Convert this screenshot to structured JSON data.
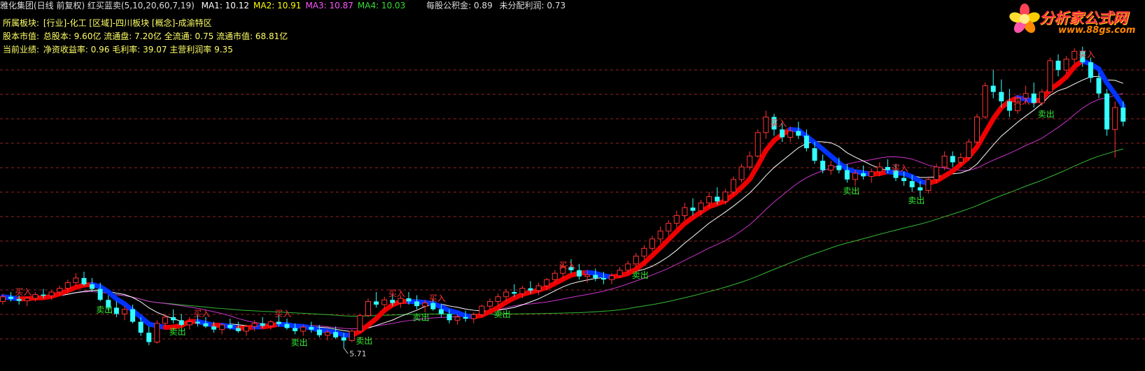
{
  "header": {
    "title": "雅化集团(日线 前复权) 红买蓝卖(5,10,20,60,7,19)",
    "ma": [
      {
        "label": "MA1",
        "value": "10.12",
        "color": "#ffffff"
      },
      {
        "label": "MA2",
        "value": "10.91",
        "color": "#ffff00"
      },
      {
        "label": "MA3",
        "value": "10.87",
        "color": "#ff55ff"
      },
      {
        "label": "MA4",
        "value": "10.03",
        "color": "#33dd33"
      }
    ],
    "per_share_reserve": "每股公积金: 0.89",
    "undistributed_profit": "未分配利润: 0.73"
  },
  "info": {
    "sector_label": "所属板块:",
    "sector_value": "[行业]-化工 [区域]-四川板块 [概念]-成渝特区",
    "capital_label": "股本市值:",
    "capital_value": "总股本: 9.60亿 流通盘: 7.20亿 全流通: 0.75 流通市值: 68.81亿",
    "perf_label": "当前业绩:",
    "perf_value": "净资收益率: 0.96 毛利率: 39.07 主营利润率 9.35"
  },
  "logo": {
    "name": "分析家公式网",
    "url": "www.88gs.com"
  },
  "colors": {
    "up": "#ff3333",
    "down": "#33ffff",
    "buy_band": "#ee0000",
    "sell_band": "#0033ff",
    "ma1": "#ffffff",
    "ma3": "#cc33cc",
    "ma4": "#33bb33",
    "grid": "#992222",
    "buy_text": "#ff3333",
    "sell_text": "#33ee33"
  },
  "chart_data": {
    "type": "candlestick",
    "title": "雅化集团(日线 前复权)",
    "low_marker": "5.71",
    "ohlc": [
      [
        7.2,
        7.45,
        7.1,
        7.35
      ],
      [
        7.35,
        7.5,
        7.2,
        7.28
      ],
      [
        7.28,
        7.4,
        7.1,
        7.22
      ],
      [
        7.22,
        7.35,
        7.05,
        7.3
      ],
      [
        7.3,
        7.5,
        7.2,
        7.42
      ],
      [
        7.42,
        7.6,
        7.3,
        7.38
      ],
      [
        7.38,
        7.55,
        7.25,
        7.5
      ],
      [
        7.5,
        7.7,
        7.4,
        7.62
      ],
      [
        7.62,
        7.9,
        7.5,
        7.8
      ],
      [
        7.8,
        8.1,
        7.7,
        7.95
      ],
      [
        7.95,
        8.15,
        7.7,
        7.75
      ],
      [
        7.75,
        7.95,
        7.5,
        7.6
      ],
      [
        7.6,
        7.8,
        7.2,
        7.25
      ],
      [
        7.25,
        7.4,
        6.9,
        7.0
      ],
      [
        7.0,
        7.2,
        6.7,
        6.8
      ],
      [
        6.8,
        7.05,
        6.6,
        6.95
      ],
      [
        6.95,
        7.1,
        6.5,
        6.55
      ],
      [
        6.55,
        6.7,
        6.1,
        6.2
      ],
      [
        6.2,
        6.4,
        5.8,
        5.9
      ],
      [
        5.9,
        6.6,
        5.85,
        6.5
      ],
      [
        6.5,
        6.8,
        6.4,
        6.7
      ],
      [
        6.7,
        6.95,
        6.5,
        6.6
      ],
      [
        6.6,
        6.8,
        6.4,
        6.45
      ],
      [
        6.45,
        6.7,
        6.3,
        6.55
      ],
      [
        6.55,
        6.75,
        6.4,
        6.5
      ],
      [
        6.5,
        6.7,
        6.35,
        6.4
      ],
      [
        6.4,
        6.55,
        6.2,
        6.3
      ],
      [
        6.3,
        6.5,
        6.15,
        6.45
      ],
      [
        6.45,
        6.65,
        6.3,
        6.35
      ],
      [
        6.35,
        6.55,
        6.2,
        6.25
      ],
      [
        6.25,
        6.45,
        6.1,
        6.4
      ],
      [
        6.4,
        6.6,
        6.25,
        6.5
      ],
      [
        6.5,
        6.7,
        6.35,
        6.42
      ],
      [
        6.42,
        6.6,
        6.3,
        6.55
      ],
      [
        6.55,
        6.75,
        6.4,
        6.48
      ],
      [
        6.48,
        6.65,
        6.3,
        6.35
      ],
      [
        6.35,
        6.5,
        6.15,
        6.25
      ],
      [
        6.25,
        6.45,
        6.1,
        6.38
      ],
      [
        6.38,
        6.55,
        6.2,
        6.3
      ],
      [
        6.3,
        6.45,
        6.05,
        6.12
      ],
      [
        6.12,
        6.3,
        5.95,
        6.22
      ],
      [
        6.22,
        6.4,
        6.0,
        6.05
      ],
      [
        6.05,
        6.2,
        5.71,
        5.95
      ],
      [
        5.95,
        6.3,
        5.9,
        6.25
      ],
      [
        6.25,
        6.8,
        6.2,
        6.75
      ],
      [
        6.75,
        7.3,
        6.7,
        7.2
      ],
      [
        7.2,
        7.5,
        7.0,
        7.1
      ],
      [
        7.1,
        7.35,
        6.95,
        7.25
      ],
      [
        7.25,
        7.45,
        7.05,
        7.15
      ],
      [
        7.15,
        7.4,
        7.0,
        7.3
      ],
      [
        7.3,
        7.5,
        7.1,
        7.2
      ],
      [
        7.2,
        7.4,
        6.95,
        7.05
      ],
      [
        7.05,
        7.25,
        6.85,
        7.15
      ],
      [
        7.15,
        7.3,
        6.9,
        6.95
      ],
      [
        6.95,
        7.1,
        6.7,
        6.8
      ],
      [
        6.8,
        6.95,
        6.5,
        6.6
      ],
      [
        6.6,
        6.8,
        6.45,
        6.7
      ],
      [
        6.7,
        6.9,
        6.55,
        6.65
      ],
      [
        6.65,
        6.85,
        6.5,
        6.78
      ],
      [
        6.78,
        7.1,
        6.7,
        7.05
      ],
      [
        7.05,
        7.3,
        6.95,
        7.2
      ],
      [
        7.2,
        7.45,
        7.05,
        7.35
      ],
      [
        7.35,
        7.6,
        7.2,
        7.5
      ],
      [
        7.5,
        7.75,
        7.35,
        7.45
      ],
      [
        7.45,
        7.7,
        7.3,
        7.62
      ],
      [
        7.62,
        7.85,
        7.45,
        7.55
      ],
      [
        7.55,
        7.8,
        7.4,
        7.7
      ],
      [
        7.7,
        7.95,
        7.55,
        7.9
      ],
      [
        7.9,
        8.2,
        7.8,
        8.1
      ],
      [
        8.1,
        8.4,
        7.95,
        8.3
      ],
      [
        8.3,
        8.55,
        8.1,
        8.2
      ],
      [
        8.2,
        8.4,
        7.9,
        8.0
      ],
      [
        8.0,
        8.2,
        7.8,
        8.05
      ],
      [
        8.05,
        8.25,
        7.85,
        7.95
      ],
      [
        7.95,
        8.15,
        7.75,
        7.9
      ],
      [
        7.9,
        8.1,
        7.75,
        8.02
      ],
      [
        8.02,
        8.3,
        7.95,
        8.2
      ],
      [
        8.2,
        8.5,
        8.1,
        8.4
      ],
      [
        8.4,
        8.75,
        8.3,
        8.65
      ],
      [
        8.65,
        9.0,
        8.55,
        8.9
      ],
      [
        8.9,
        9.3,
        8.8,
        9.2
      ],
      [
        9.2,
        9.6,
        9.05,
        9.45
      ],
      [
        9.45,
        9.8,
        9.3,
        9.7
      ],
      [
        9.7,
        10.1,
        9.55,
        9.95
      ],
      [
        9.95,
        10.35,
        9.8,
        10.2
      ],
      [
        10.2,
        10.5,
        9.95,
        10.1
      ],
      [
        10.1,
        10.45,
        9.95,
        10.35
      ],
      [
        10.35,
        10.7,
        10.2,
        10.55
      ],
      [
        10.55,
        10.85,
        10.3,
        10.4
      ],
      [
        10.4,
        10.8,
        10.3,
        10.7
      ],
      [
        10.7,
        11.2,
        10.6,
        11.1
      ],
      [
        11.1,
        11.6,
        11.0,
        11.5
      ],
      [
        11.5,
        12.0,
        11.4,
        11.85
      ],
      [
        11.85,
        12.7,
        11.8,
        12.6
      ],
      [
        12.6,
        13.3,
        12.4,
        13.1
      ],
      [
        13.1,
        13.2,
        12.5,
        12.7
      ],
      [
        12.7,
        12.9,
        12.3,
        12.45
      ],
      [
        12.45,
        12.8,
        12.3,
        12.65
      ],
      [
        12.65,
        12.95,
        12.4,
        12.5
      ],
      [
        12.5,
        12.7,
        12.0,
        12.1
      ],
      [
        12.1,
        12.3,
        11.6,
        11.7
      ],
      [
        11.7,
        11.9,
        11.3,
        11.4
      ],
      [
        11.4,
        11.7,
        11.25,
        11.55
      ],
      [
        11.55,
        11.8,
        11.3,
        11.4
      ],
      [
        11.4,
        11.6,
        11.0,
        11.1
      ],
      [
        11.1,
        11.4,
        10.9,
        11.3
      ],
      [
        11.3,
        11.55,
        11.1,
        11.2
      ],
      [
        11.2,
        11.45,
        11.0,
        11.35
      ],
      [
        11.35,
        11.65,
        11.2,
        11.5
      ],
      [
        11.5,
        11.75,
        11.3,
        11.4
      ],
      [
        11.4,
        11.6,
        11.05,
        11.15
      ],
      [
        11.15,
        11.35,
        10.9,
        11.05
      ],
      [
        11.05,
        11.25,
        10.7,
        10.85
      ],
      [
        10.85,
        11.05,
        10.55,
        10.75
      ],
      [
        10.75,
        11.2,
        10.65,
        11.1
      ],
      [
        11.1,
        11.6,
        11.0,
        11.5
      ],
      [
        11.5,
        12.0,
        11.4,
        11.85
      ],
      [
        11.85,
        12.0,
        11.5,
        11.65
      ],
      [
        11.65,
        11.95,
        11.55,
        11.8
      ],
      [
        11.8,
        12.4,
        11.7,
        12.3
      ],
      [
        12.3,
        13.2,
        12.25,
        13.1
      ],
      [
        13.1,
        14.2,
        13.05,
        14.1
      ],
      [
        14.1,
        14.6,
        13.7,
        13.9
      ],
      [
        13.9,
        14.3,
        13.4,
        13.6
      ],
      [
        13.6,
        14.0,
        13.1,
        13.3
      ],
      [
        13.3,
        13.8,
        13.2,
        13.7
      ],
      [
        13.7,
        14.1,
        13.5,
        13.85
      ],
      [
        13.85,
        14.2,
        13.4,
        13.55
      ],
      [
        13.55,
        14.0,
        13.45,
        13.9
      ],
      [
        13.9,
        15.0,
        13.85,
        14.9
      ],
      [
        14.9,
        15.1,
        14.4,
        14.6
      ],
      [
        14.6,
        15.05,
        14.5,
        14.95
      ],
      [
        14.95,
        15.3,
        14.8,
        15.2
      ],
      [
        15.2,
        15.35,
        14.7,
        14.85
      ],
      [
        14.85,
        15.0,
        14.2,
        14.35
      ],
      [
        14.35,
        14.5,
        13.7,
        13.85
      ],
      [
        13.85,
        14.0,
        12.5,
        12.7
      ],
      [
        12.7,
        13.6,
        11.8,
        13.4
      ],
      [
        13.4,
        13.6,
        12.8,
        12.95
      ]
    ],
    "buy_points": [
      2,
      24,
      34,
      48,
      53,
      69,
      95,
      110,
      125,
      133
    ],
    "sell_points": [
      12,
      21,
      36,
      44,
      51,
      61,
      78,
      104,
      112,
      128,
      139
    ],
    "signal_labels": {
      "buy": "买入",
      "sell": "卖出"
    },
    "ylim": [
      5.4,
      15.5
    ]
  }
}
